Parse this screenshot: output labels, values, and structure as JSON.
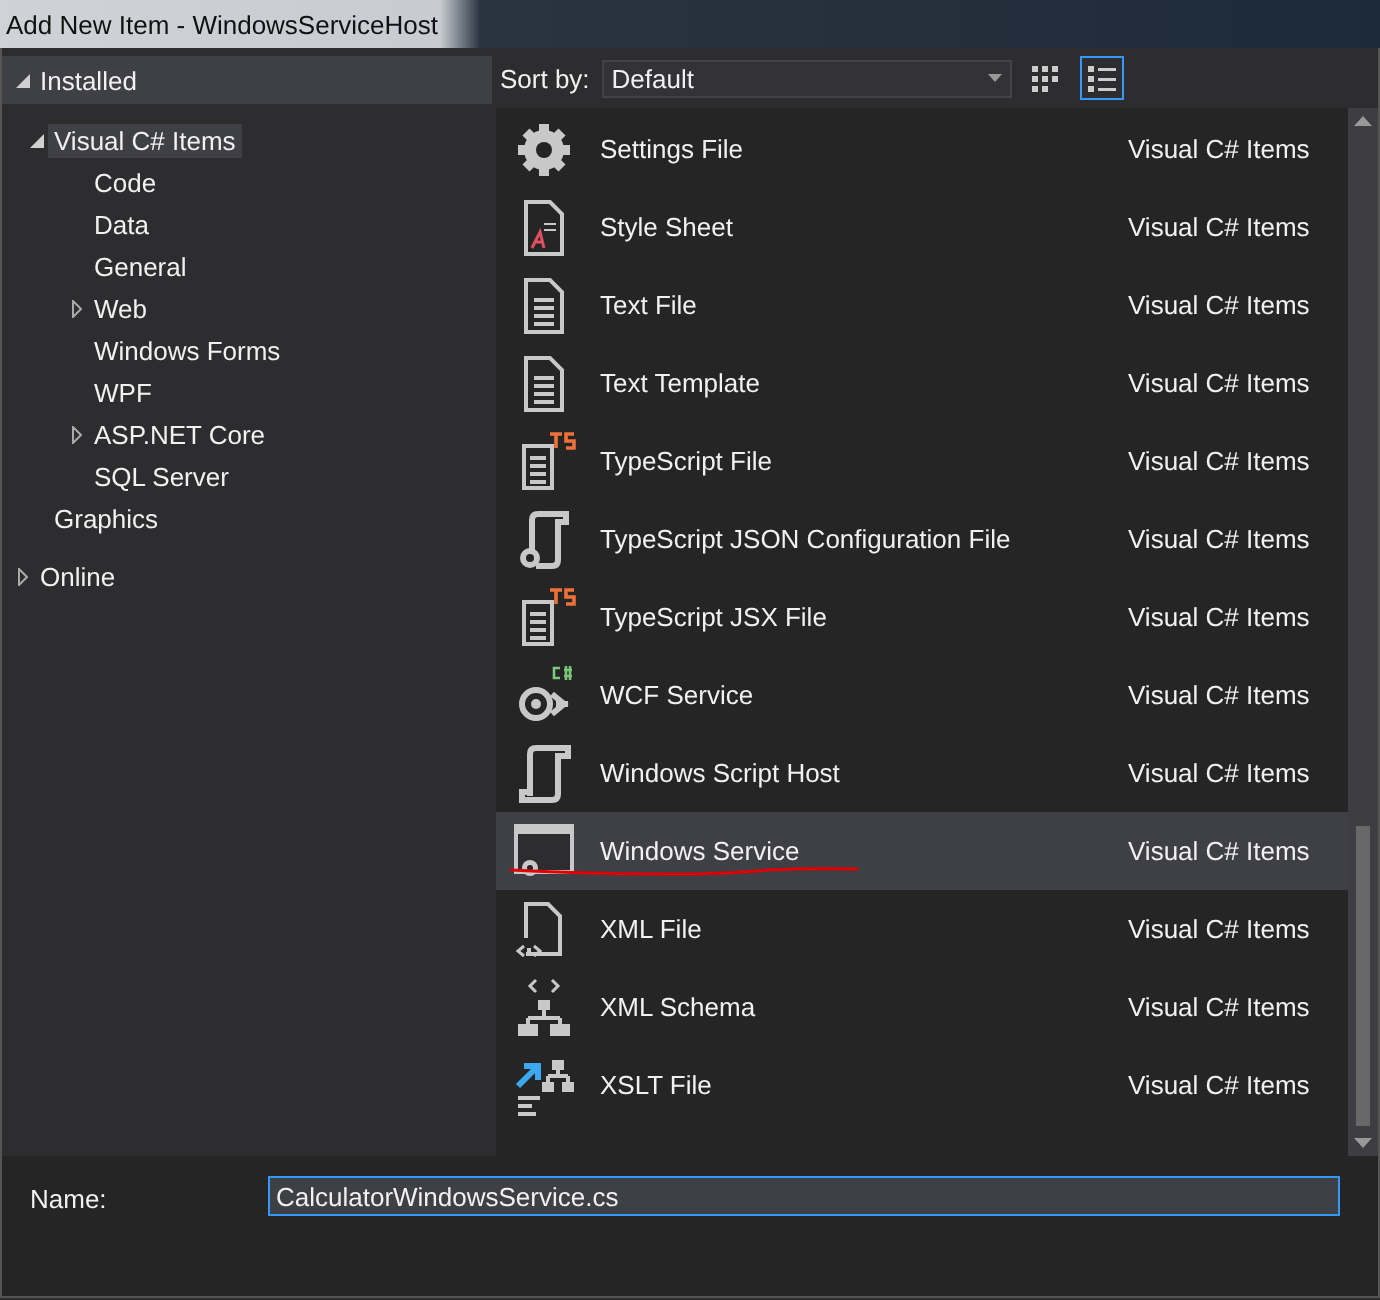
{
  "window": {
    "title": "Add New Item - WindowsServiceHost"
  },
  "tree": [
    {
      "label": "Installed",
      "expanded": true,
      "selected": false,
      "children": [
        {
          "label": "Visual C# Items",
          "expanded": true,
          "selected": true,
          "children": [
            {
              "label": "Code",
              "selected": false
            },
            {
              "label": "Data",
              "selected": false
            },
            {
              "label": "General",
              "selected": false
            },
            {
              "label": "Web",
              "expanded": false,
              "selected": false
            },
            {
              "label": "Windows Forms",
              "selected": false
            },
            {
              "label": "WPF",
              "selected": false
            },
            {
              "label": "ASP.NET Core",
              "expanded": false,
              "selected": false
            },
            {
              "label": "SQL Server",
              "selected": false
            }
          ]
        },
        {
          "label": "Graphics",
          "selected": false
        }
      ]
    },
    {
      "label": "Online",
      "expanded": false,
      "selected": false
    }
  ],
  "toolbar": {
    "sort_label": "Sort by:",
    "sort_value": "Default",
    "views": [
      {
        "kind": "grid",
        "selected": false
      },
      {
        "kind": "list",
        "selected": true
      }
    ]
  },
  "items": [
    {
      "name": "Settings File",
      "category": "Visual C# Items",
      "kind": "gear",
      "selected": false
    },
    {
      "name": "Style Sheet",
      "category": "Visual C# Items",
      "kind": "stylesheet",
      "selected": false
    },
    {
      "name": "Text File",
      "category": "Visual C# Items",
      "kind": "text",
      "selected": false
    },
    {
      "name": "Text Template",
      "category": "Visual C# Items",
      "kind": "text",
      "selected": false
    },
    {
      "name": "TypeScript File",
      "category": "Visual C# Items",
      "kind": "ts",
      "selected": false
    },
    {
      "name": "TypeScript JSON Configuration File",
      "category": "Visual C# Items",
      "kind": "scroll",
      "selected": false
    },
    {
      "name": "TypeScript JSX File",
      "category": "Visual C# Items",
      "kind": "ts",
      "selected": false
    },
    {
      "name": "WCF Service",
      "category": "Visual C# Items",
      "kind": "wcf",
      "selected": false
    },
    {
      "name": "Windows Script Host",
      "category": "Visual C# Items",
      "kind": "script",
      "selected": false
    },
    {
      "name": "Windows Service",
      "category": "Visual C# Items",
      "kind": "service",
      "selected": true
    },
    {
      "name": "XML File",
      "category": "Visual C# Items",
      "kind": "xml",
      "selected": false
    },
    {
      "name": "XML Schema",
      "category": "Visual C# Items",
      "kind": "schema",
      "selected": false
    },
    {
      "name": "XSLT File",
      "category": "Visual C# Items",
      "kind": "xslt",
      "selected": false
    }
  ],
  "name_field": {
    "label": "Name:",
    "value": "CalculatorWindowsService.cs"
  }
}
